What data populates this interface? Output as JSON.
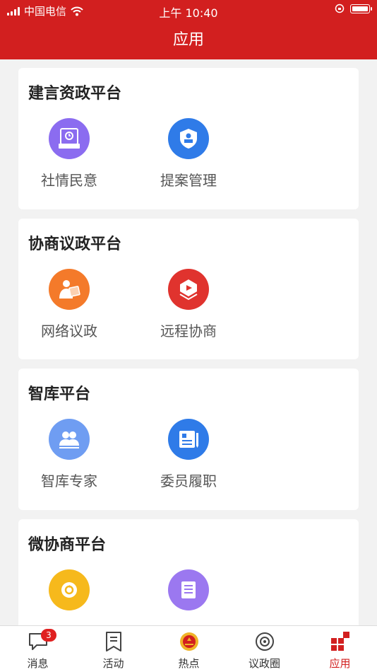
{
  "status_bar": {
    "carrier": "中国电信",
    "time": "上午 10:40"
  },
  "header": {
    "title": "应用"
  },
  "sections": [
    {
      "title": "建言资政平台",
      "apps": [
        {
          "label": "社情民意",
          "icon": "public-opinion-icon",
          "color": "#8b6cf0"
        },
        {
          "label": "提案管理",
          "icon": "proposal-shield-icon",
          "color": "#2f7be8"
        }
      ]
    },
    {
      "title": "协商议政平台",
      "apps": [
        {
          "label": "网络议政",
          "icon": "online-discussion-icon",
          "color": "#f47a2a"
        },
        {
          "label": "远程协商",
          "icon": "remote-consultation-icon",
          "color": "#e0332e"
        }
      ]
    },
    {
      "title": "智库平台",
      "apps": [
        {
          "label": "智库专家",
          "icon": "experts-icon",
          "color": "#6f9df2"
        },
        {
          "label": "委员履职",
          "icon": "duty-record-icon",
          "color": "#2f7be8"
        }
      ]
    },
    {
      "title": "微协商平台",
      "apps": [
        {
          "label": "",
          "icon": "micro-consult-icon",
          "color": "#f6b91c"
        },
        {
          "label": "",
          "icon": "document-list-icon",
          "color": "#9b78f0"
        }
      ]
    }
  ],
  "tabbar": {
    "tabs": [
      {
        "label": "消息",
        "icon": "message-icon",
        "badge": "3"
      },
      {
        "label": "活动",
        "icon": "activity-icon"
      },
      {
        "label": "热点",
        "icon": "emblem-icon"
      },
      {
        "label": "议政圈",
        "icon": "circle-icon"
      },
      {
        "label": "应用",
        "icon": "apps-icon",
        "active": true
      }
    ]
  },
  "colors": {
    "brand": "#d21f1f",
    "background": "#f2f2f2"
  }
}
